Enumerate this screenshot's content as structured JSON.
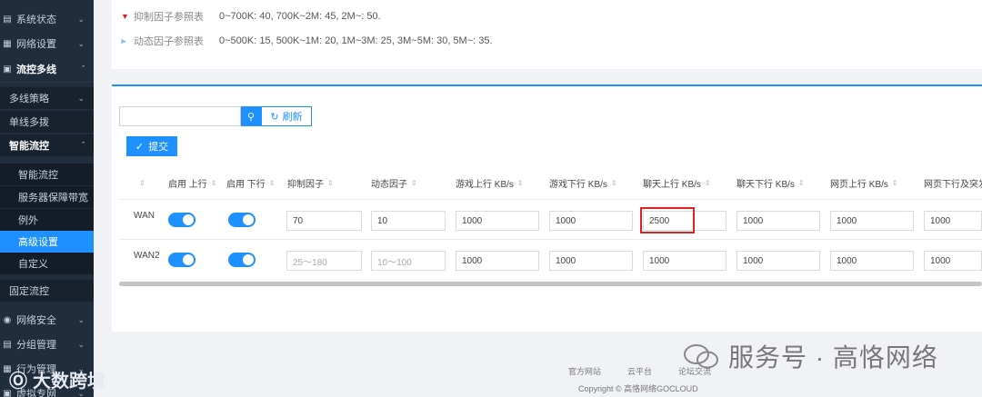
{
  "sidebar": {
    "items": [
      {
        "label": "系统状态",
        "icon": "chart-icon"
      },
      {
        "label": "网络设置",
        "icon": "network-icon"
      },
      {
        "label": "流控多线",
        "icon": "flow-icon"
      },
      {
        "label": "多线策略"
      },
      {
        "label": "单线多拨"
      },
      {
        "label": "智能流控"
      },
      {
        "label": "智能流控"
      },
      {
        "label": "服务器保障带宽"
      },
      {
        "label": "例外"
      },
      {
        "label": "高级设置"
      },
      {
        "label": "自定义"
      },
      {
        "label": "固定流控"
      },
      {
        "label": "网络安全",
        "icon": "globe-icon"
      },
      {
        "label": "分组管理",
        "icon": "group-icon"
      },
      {
        "label": "行为管理",
        "icon": "behavior-icon"
      },
      {
        "label": "虚拟专网",
        "icon": "vpn-icon"
      }
    ]
  },
  "references": [
    {
      "label": "抑制因子参照表",
      "text": "0~700K: 40, 700K~2M: 45, 2M~: 50.",
      "icon": "down-triangle-icon",
      "icon_color": "#e02020"
    },
    {
      "label": "动态因子参照表",
      "text": "0~500K: 15, 500K~1M: 20, 1M~3M: 25, 3M~5M: 30, 5M~: 35.",
      "icon": "share-icon",
      "icon_color": "#1e90ff"
    }
  ],
  "toolbar": {
    "search_placeholder": "",
    "search_icon": "search-icon",
    "refresh_label": "刷新",
    "submit_label": "提交"
  },
  "table": {
    "headers": [
      "启用 上行",
      "启用 下行",
      "抑制因子",
      "动态因子",
      "游戏上行 KB/s",
      "游戏下行 KB/s",
      "聊天上行 KB/s",
      "聊天下行 KB/s",
      "网页上行 KB/s",
      "网页下行及突发"
    ],
    "rows": [
      {
        "name": "WAN",
        "up_enabled": true,
        "down_enabled": true,
        "suppress": "70",
        "dynamic": "10",
        "game_up": "1000",
        "game_down": "1000",
        "chat_up": "2500",
        "chat_down": "1000",
        "web_up": "1000",
        "web_down": "1000"
      },
      {
        "name": "WAN2",
        "up_enabled": true,
        "down_enabled": true,
        "suppress_placeholder": "25～180",
        "dynamic_placeholder": "10～100",
        "game_up": "1000",
        "game_down": "1000",
        "chat_up": "1000",
        "chat_down": "1000",
        "web_up": "1000",
        "web_down": "1000"
      }
    ]
  },
  "footer": {
    "links": [
      "官方网站",
      "云平台",
      "论坛交流"
    ],
    "copyright": "Copyright © 高恪网络GOCLOUD"
  },
  "watermarks": {
    "right": "服务号 · 高恪网络",
    "left": "大数跨境"
  }
}
